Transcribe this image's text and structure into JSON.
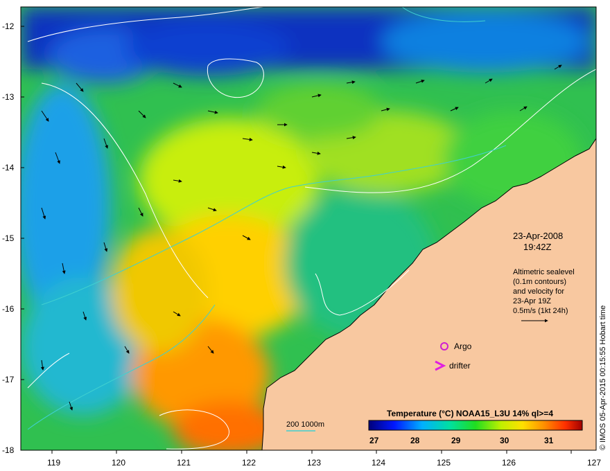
{
  "map": {
    "lat_labels": [
      "-12",
      "-13",
      "-14",
      "-15",
      "-16",
      "-17",
      "-18"
    ],
    "lon_labels": [
      "119",
      "120",
      "121",
      "122",
      "123",
      "124",
      "125",
      "126",
      "127"
    ],
    "lat_range": [
      -18,
      -11.65
    ],
    "lon_range": [
      118.6,
      127
    ]
  },
  "annotations": {
    "date": "23-Apr-2008",
    "time": "19:42Z",
    "alti_line1": "Altimetric sealevel",
    "alti_line2": "(0.1m contours)",
    "alti_line3": "and velocity for",
    "alti_line4": "23-Apr 19Z",
    "alti_line5": "0.5m/s (1kt 24h)",
    "argo_label": "Argo",
    "drifter_label": "drifter",
    "bathy_label": "200  1000m"
  },
  "colorbar": {
    "title": "Temperature (°C) NOAA15_L3U 14% ql>=4",
    "ticks": [
      "27",
      "28",
      "29",
      "30",
      "31"
    ],
    "range": [
      26.6,
      31.8
    ]
  },
  "credit": "© IMOS 05-Apr-2015 00:15:55 Hobart time",
  "colors": {
    "land": "#f8c8a0",
    "argo": "#d01fd0",
    "drifter": "#e020e0",
    "contour": "#ffffff",
    "bathy": "#40d0d0"
  }
}
